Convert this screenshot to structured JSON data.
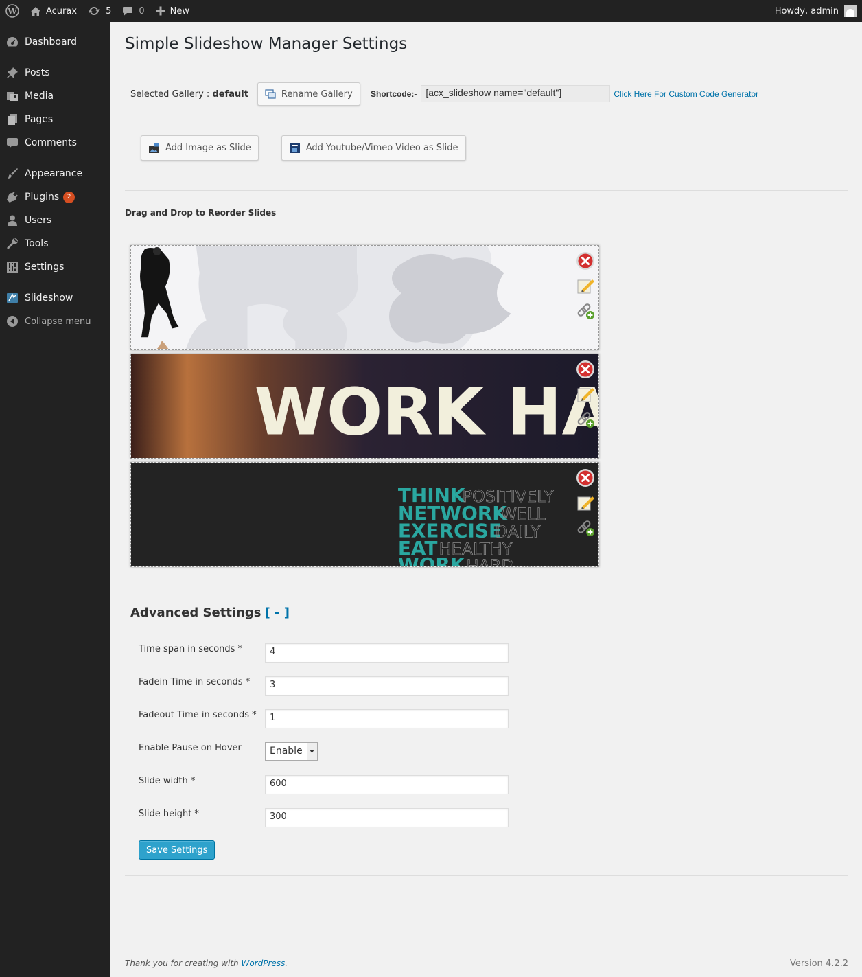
{
  "adminbar": {
    "site_name": "Acurax",
    "updates_count": "5",
    "comments_count": "0",
    "new_label": "New",
    "howdy": "Howdy, admin"
  },
  "sidebar": {
    "items": [
      {
        "label": "Dashboard",
        "icon": "dashboard-icon"
      },
      {
        "label": "Posts",
        "icon": "pushpin-icon"
      },
      {
        "label": "Media",
        "icon": "media-icon"
      },
      {
        "label": "Pages",
        "icon": "pages-icon"
      },
      {
        "label": "Comments",
        "icon": "comment-icon"
      },
      {
        "label": "Appearance",
        "icon": "brush-icon"
      },
      {
        "label": "Plugins",
        "icon": "plugin-icon",
        "badge": "2"
      },
      {
        "label": "Users",
        "icon": "user-icon"
      },
      {
        "label": "Tools",
        "icon": "wrench-icon"
      },
      {
        "label": "Settings",
        "icon": "settings-icon"
      },
      {
        "label": "Slideshow",
        "icon": "slideshow-icon"
      }
    ],
    "collapse_label": "Collapse menu"
  },
  "main": {
    "title": "Simple Slideshow Manager Settings",
    "selected_gallery_label": "Selected Gallery : ",
    "selected_gallery_value": "default",
    "rename_button": "Rename Gallery",
    "shortcode_label": "Shortcode:-",
    "shortcode_value": "[acx_slideshow name=\"default\"]",
    "custom_code_link": "Click Here For Custom Code Generator",
    "add_image_button": "Add Image as Slide",
    "add_video_button": "Add Youtube/Vimeo Video as Slide",
    "reorder_label": "Drag and Drop to Reorder Slides",
    "slides": [
      {
        "text": ""
      },
      {
        "text": "WORK HARD"
      },
      {
        "lines": [
          [
            "THINK",
            "POSITIVELY"
          ],
          [
            "NETWORK",
            "WELL"
          ],
          [
            "EXERCISE",
            "DAILY"
          ],
          [
            "EAT",
            "HEALTHY"
          ],
          [
            "WORK",
            "HARD"
          ]
        ]
      }
    ]
  },
  "advanced": {
    "title": "Advanced Settings",
    "toggle": "[ - ]",
    "fields": [
      {
        "label": "Time span in seconds *",
        "value": "4"
      },
      {
        "label": "Fadein Time in seconds *",
        "value": "3"
      },
      {
        "label": "Fadeout Time in seconds *",
        "value": "1"
      },
      {
        "label": "Enable Pause on Hover",
        "value": "Enable"
      },
      {
        "label": "Slide width *",
        "value": "600"
      },
      {
        "label": "Slide height *",
        "value": "300"
      }
    ],
    "save_button": "Save Settings"
  },
  "footer": {
    "thanks_prefix": "Thank you for creating with ",
    "wordpress_link": "WordPress",
    "thanks_suffix": ".",
    "version": "Version 4.2.2"
  }
}
